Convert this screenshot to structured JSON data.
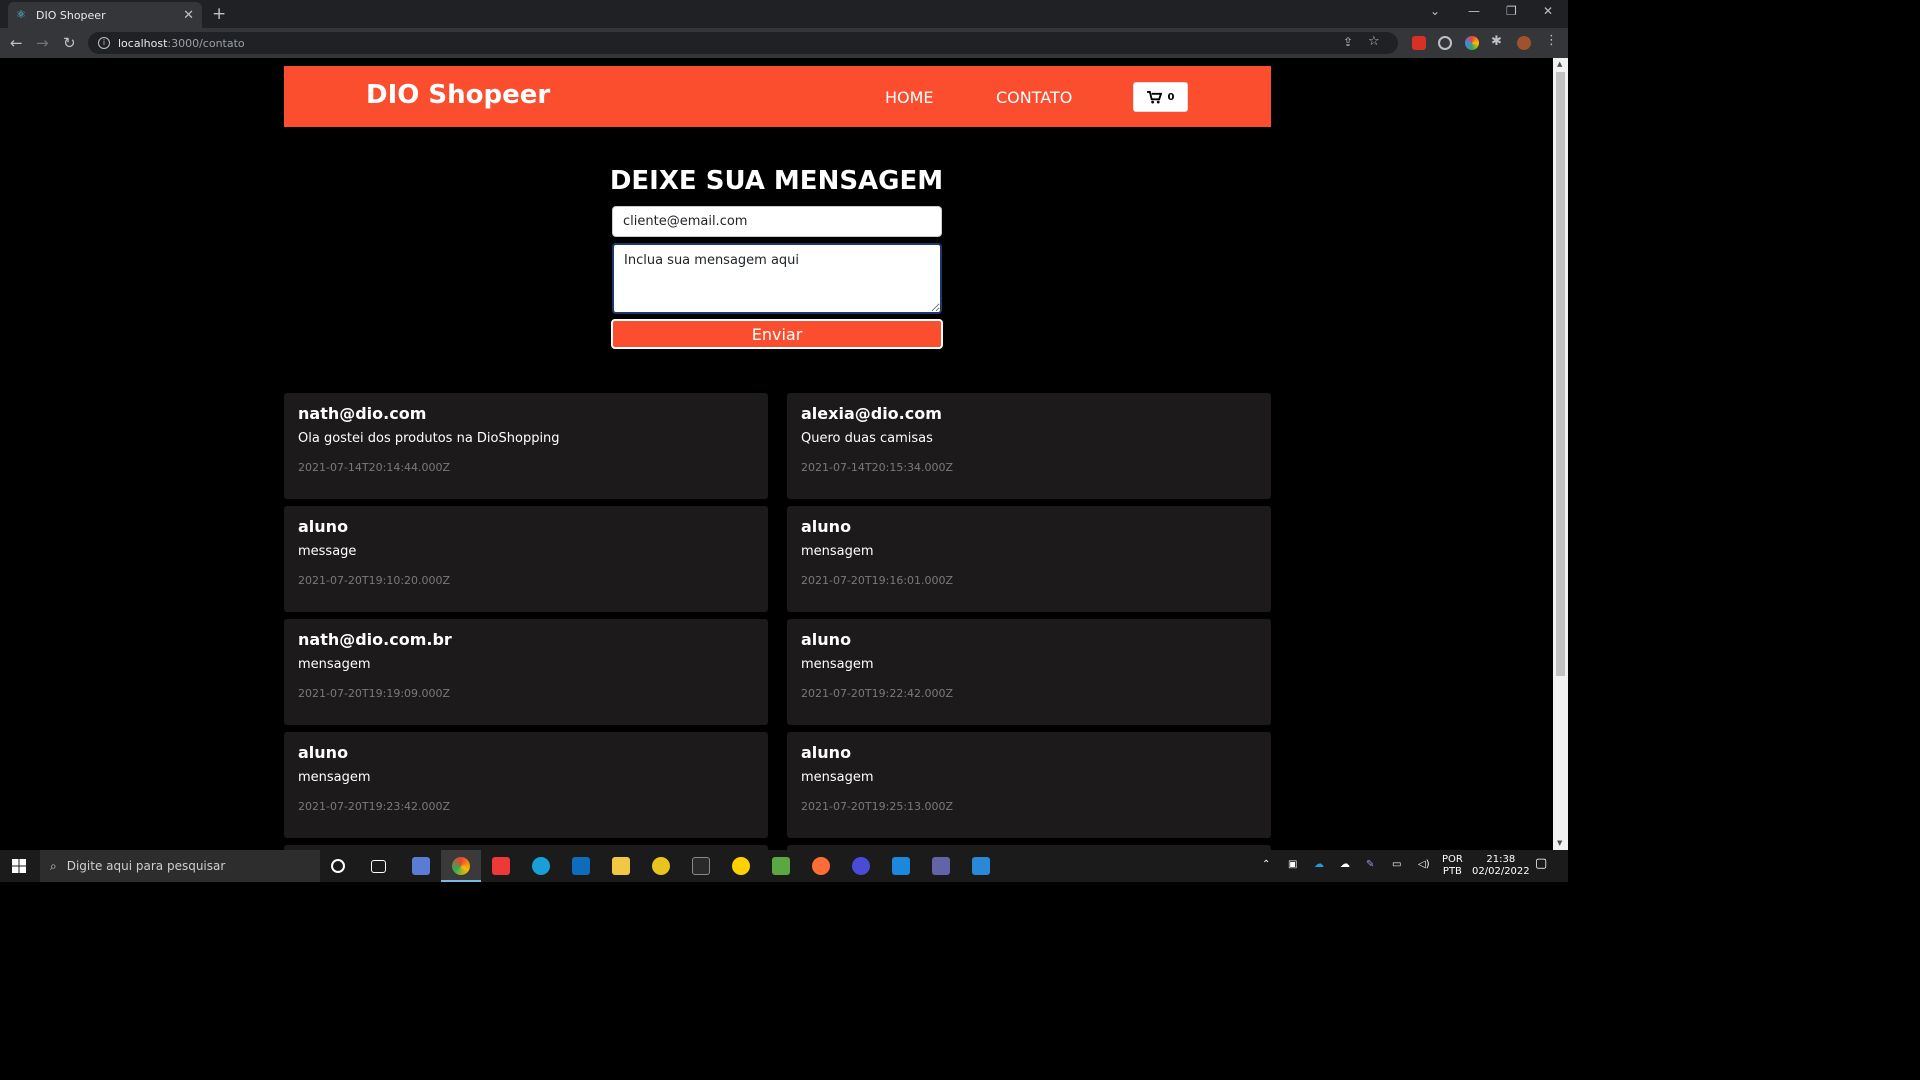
{
  "browser": {
    "tab_title": "DIO Shopeer",
    "url_host": "localhost",
    "url_path": ":3000/contato"
  },
  "navbar": {
    "brand": "DIO Shopeer",
    "links": [
      "HOME",
      "CONTATO"
    ],
    "cart_count": "0",
    "color": "#fa4e2f"
  },
  "form": {
    "title": "DEIXE SUA MENSAGEM",
    "email_value": "cliente@email.com",
    "message_value": "Inclua sua mensagem aqui",
    "submit_label": "Enviar"
  },
  "messages": [
    {
      "email": "nath@dio.com",
      "message": "Ola gostei dos produtos na DioShopping",
      "date": "2021-07-14T20:14:44.000Z"
    },
    {
      "email": "alexia@dio.com",
      "message": "Quero duas camisas",
      "date": "2021-07-14T20:15:34.000Z"
    },
    {
      "email": "aluno",
      "message": "message",
      "date": "2021-07-20T19:10:20.000Z"
    },
    {
      "email": "aluno",
      "message": "mensagem",
      "date": "2021-07-20T19:16:01.000Z"
    },
    {
      "email": "nath@dio.com.br",
      "message": "mensagem",
      "date": "2021-07-20T19:19:09.000Z"
    },
    {
      "email": "aluno",
      "message": "mensagem",
      "date": "2021-07-20T19:22:42.000Z"
    },
    {
      "email": "aluno",
      "message": "mensagem",
      "date": "2021-07-20T19:23:42.000Z"
    },
    {
      "email": "aluno",
      "message": "mensagem",
      "date": "2021-07-20T19:25:13.000Z"
    }
  ],
  "taskbar": {
    "search_placeholder": "Digite aqui para pesquisar",
    "lang_top": "POR",
    "lang_bottom": "PTB",
    "time": "21:38",
    "date": "02/02/2022"
  }
}
